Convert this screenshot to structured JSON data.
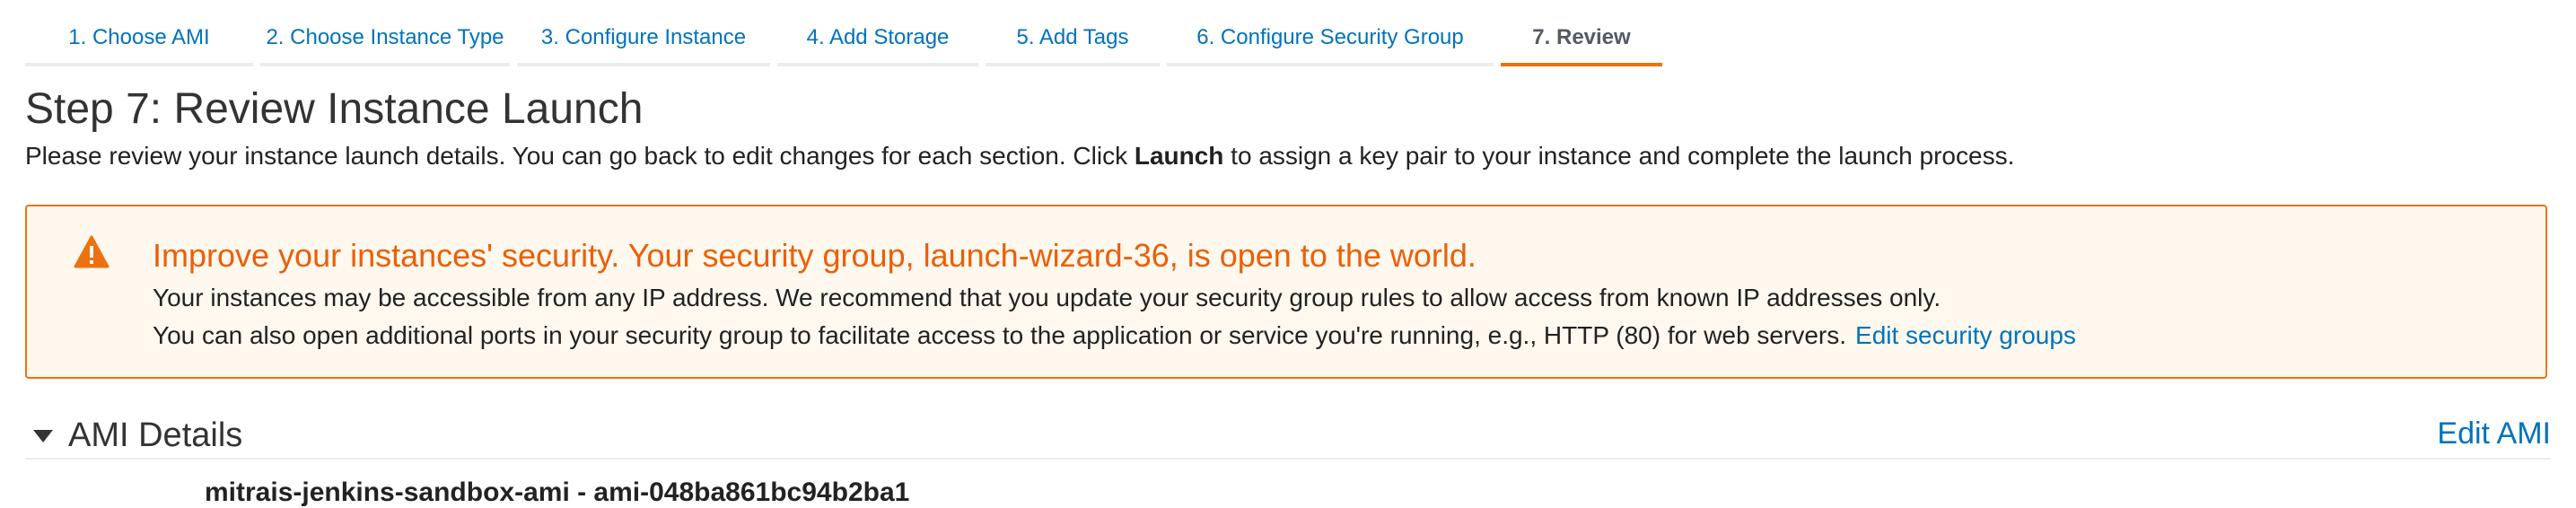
{
  "tabs": [
    {
      "label": "1. Choose AMI"
    },
    {
      "label": "2. Choose Instance Type"
    },
    {
      "label": "3. Configure Instance"
    },
    {
      "label": "4. Add Storage"
    },
    {
      "label": "5. Add Tags"
    },
    {
      "label": "6. Configure Security Group"
    },
    {
      "label": "7. Review",
      "active": true
    }
  ],
  "page": {
    "title": "Step 7: Review Instance Launch",
    "intro_before": "Please review your instance launch details. You can go back to edit changes for each section. Click ",
    "intro_bold": "Launch",
    "intro_after": " to assign a key pair to your instance and complete the launch process."
  },
  "alert": {
    "icon": "warning-triangle-icon",
    "title": "Improve your instances' security. Your security group, launch-wizard-36, is open to the world.",
    "line1": "Your instances may be accessible from any IP address. We recommend that you update your security group rules to allow access from known IP addresses only.",
    "line2": "You can also open additional ports in your security group to facilitate access to the application or service you're running, e.g., HTTP (80) for web servers.",
    "link": "Edit security groups",
    "colors": {
      "border": "#ec7211",
      "background": "#fef8ee",
      "title": "#eb5f07"
    }
  },
  "ami_section": {
    "title": "AMI Details",
    "edit_label": "Edit AMI",
    "ami_name": "mitrais-jenkins-sandbox-ami - ami-048ba861bc94b2ba1"
  },
  "colors": {
    "link": "#0073bb",
    "active_tab_underline": "#ec7211"
  }
}
